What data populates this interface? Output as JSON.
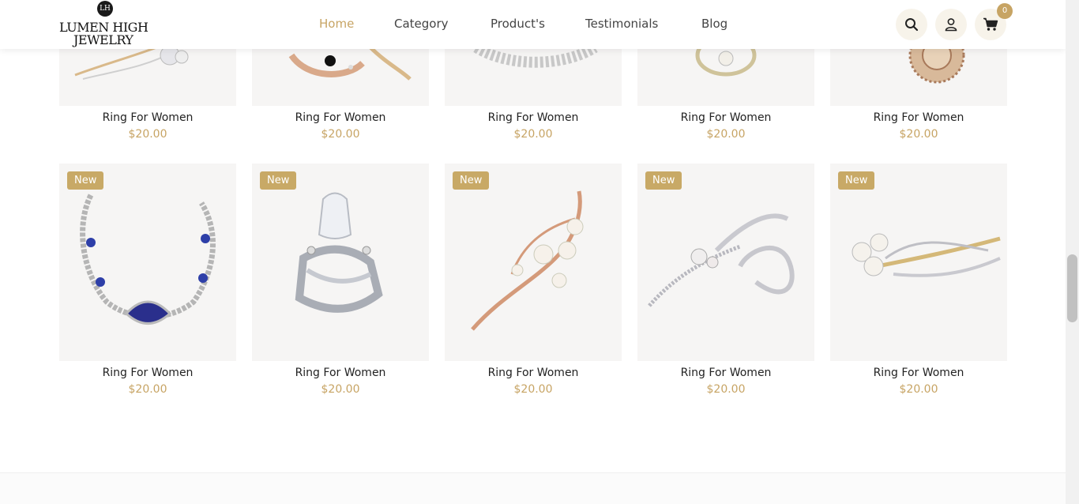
{
  "brand": {
    "mark": "LH",
    "line1": "LUMEN HIGH",
    "line2": "JEWELRY"
  },
  "nav": [
    {
      "label": "Home",
      "active": true
    },
    {
      "label": "Category",
      "active": false
    },
    {
      "label": "Product's",
      "active": false
    },
    {
      "label": "Testimonials",
      "active": false
    },
    {
      "label": "Blog",
      "active": false
    }
  ],
  "header_icons": [
    "search-icon",
    "user-icon",
    "cart-icon"
  ],
  "cart": {
    "count": "0"
  },
  "colors": {
    "accent": "#c7a464",
    "badge": "#c8a966"
  },
  "products_top": [
    {
      "name": "Ring For Women",
      "price": "$20.00",
      "icon": "brooch-image"
    },
    {
      "name": "Ring For Women",
      "price": "$20.00",
      "icon": "brooch-image"
    },
    {
      "name": "Ring For Women",
      "price": "$20.00",
      "icon": "bracelet-image"
    },
    {
      "name": "Ring For Women",
      "price": "$20.00",
      "icon": "pearl-brooch-image"
    },
    {
      "name": "Ring For Women",
      "price": "$20.00",
      "icon": "round-brooch-image"
    }
  ],
  "products": [
    {
      "badge": "New",
      "name": "Ring For Women",
      "price": "$20.00",
      "icon": "sapphire-bracelet-image"
    },
    {
      "badge": "New",
      "name": "Ring For Women",
      "price": "$20.00",
      "icon": "diamond-ring-image"
    },
    {
      "badge": "New",
      "name": "Ring For Women",
      "price": "$20.00",
      "icon": "pearl-leaf-brooch-image"
    },
    {
      "badge": "New",
      "name": "Ring For Women",
      "price": "$20.00",
      "icon": "silver-flower-brooch-image"
    },
    {
      "badge": "New",
      "name": "Ring For Women",
      "price": "$20.00",
      "icon": "pearl-spray-brooch-image"
    }
  ]
}
